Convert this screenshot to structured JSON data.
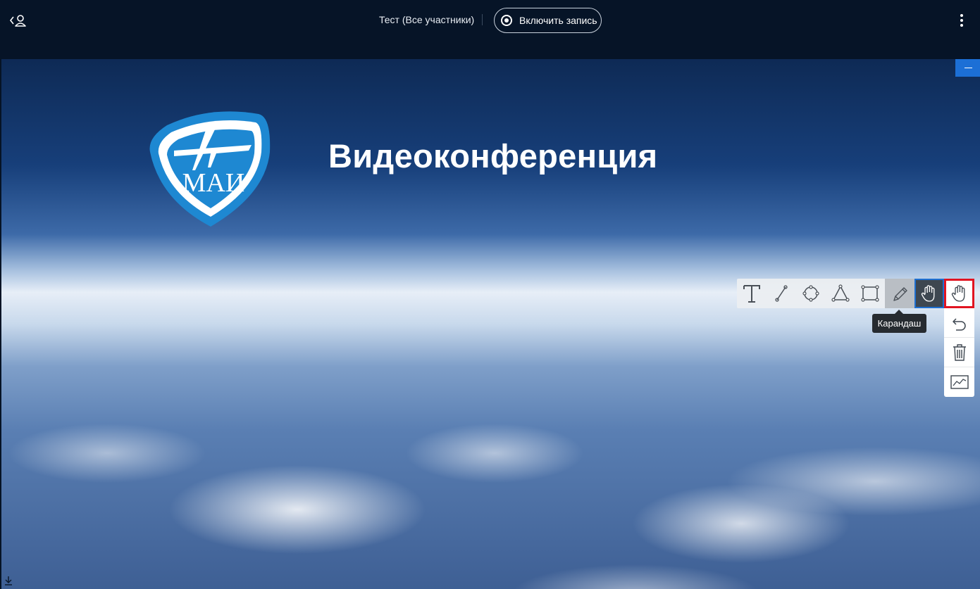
{
  "header": {
    "conference_title": "Тест (Все участники)",
    "record_label": "Включить запись",
    "back_icon": "back-user-icon",
    "menu_icon": "more-vertical-icon"
  },
  "slide": {
    "title": "Видеоконференция",
    "logo_text": "МАИ",
    "minimize_icon": "minimize-icon"
  },
  "toolbar": {
    "tools": [
      {
        "name": "text",
        "icon": "text-tool-icon"
      },
      {
        "name": "line",
        "icon": "line-tool-icon"
      },
      {
        "name": "ellipse",
        "icon": "ellipse-tool-icon"
      },
      {
        "name": "triangle",
        "icon": "triangle-tool-icon"
      },
      {
        "name": "rectangle",
        "icon": "rectangle-tool-icon"
      },
      {
        "name": "pencil",
        "icon": "pencil-tool-icon"
      },
      {
        "name": "hand",
        "icon": "hand-tool-icon"
      }
    ],
    "tooltip": "Карандаш",
    "side": [
      "undo-icon",
      "trash-icon",
      "chart-icon"
    ]
  },
  "colors": {
    "topbar": "#061427",
    "accent": "#1c6fd6",
    "highlight": "#e11421",
    "logo_blue": "#1e88d2"
  }
}
